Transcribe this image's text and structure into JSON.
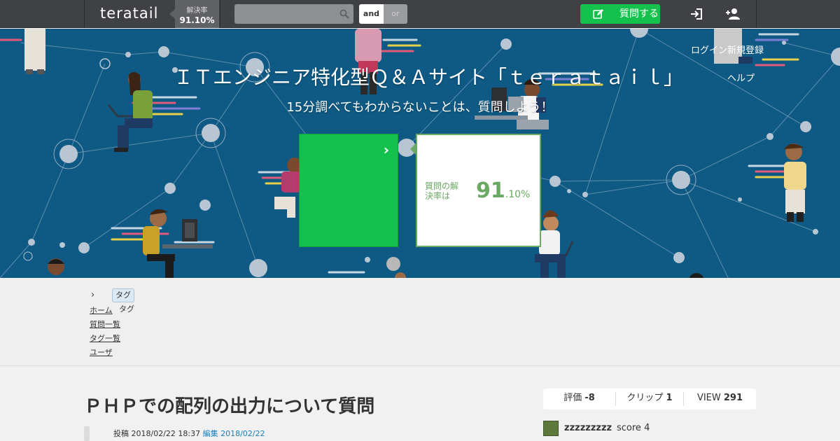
{
  "header": {
    "logo": "teratail",
    "rate_label": "解決率",
    "rate_value": "91.10%",
    "search_placeholder": "",
    "and_label": "and",
    "or_label": "or",
    "ask_label": "質問する"
  },
  "hero": {
    "title": "ＩＴエンジニア特化型Ｑ＆Ａサイト「ｔｅｒａｔａｉｌ」",
    "subtitle": "15分調べてもわからないことは、質問しよう！",
    "user_links": [
      "ログイン",
      "新規登録",
      "ヘルプ"
    ],
    "rate_label": "質問の解決率は",
    "rate_int": "91",
    "rate_dec": ".10%",
    "colors": {
      "background": "#0e5a84",
      "green": "#13c14c",
      "rate_green": "#6aa864"
    }
  },
  "crumbs": {
    "chevron": "›",
    "active_tag": "タグ",
    "sub_tag": "タグ",
    "links": [
      "ホーム",
      "質問一覧",
      "タグ一覧",
      "ユーザ"
    ]
  },
  "question": {
    "title": "ＰＨＰでの配列の出力について質問",
    "posted_label": "投稿",
    "posted_date": "2018/02/22 18:37",
    "updated_label": "編集",
    "updated_date": "2018/02/22"
  },
  "stats": {
    "score_label": "評価",
    "score_value": "-8",
    "clip_label": "クリップ",
    "clip_value": "1",
    "view_label": "VIEW",
    "view_value": "291"
  },
  "author": {
    "name": "zzzzzzzzz",
    "score_label": "score",
    "score_value": "4"
  }
}
